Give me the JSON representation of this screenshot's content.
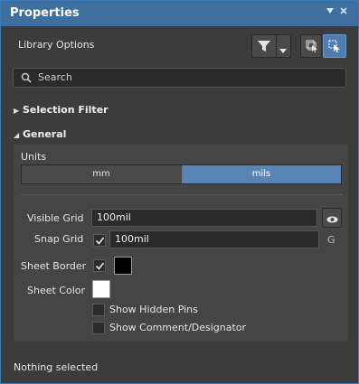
{
  "window": {
    "title": "Properties"
  },
  "header": {
    "label": "Library Options"
  },
  "search": {
    "placeholder": "Search"
  },
  "sections": {
    "selection_filter": "Selection Filter",
    "general": "General"
  },
  "units": {
    "label": "Units",
    "options": [
      "mm",
      "mils"
    ],
    "selected": "mils"
  },
  "visible_grid": {
    "label": "Visible Grid",
    "value": "100mil"
  },
  "snap_grid": {
    "label": "Snap Grid",
    "value": "100mil",
    "hotkey": "G",
    "checked": true
  },
  "sheet_border": {
    "label": "Sheet Border",
    "checked": true,
    "color": "#000000"
  },
  "sheet_color": {
    "label": "Sheet Color",
    "color": "#ffffff"
  },
  "options": [
    {
      "label": "Show Hidden Pins",
      "checked": false
    },
    {
      "label": "Show Comment/Designator",
      "checked": false
    }
  ],
  "status": "Nothing selected",
  "colors": {
    "titlebar": "#3e6f9e",
    "selected_segment": "#5a84b4",
    "accent": "#3b7bb8"
  },
  "icons": [
    "pin-icon",
    "close-icon",
    "filter-icon",
    "dropdown-arrow-icon",
    "select-overlapped-icon",
    "select-pointer-icon",
    "search-icon",
    "eye-icon",
    "checkmark-icon"
  ]
}
